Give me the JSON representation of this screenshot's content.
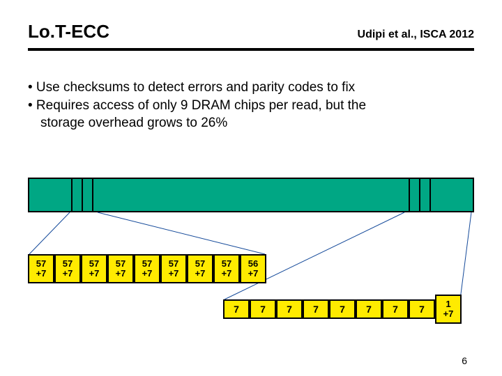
{
  "header": {
    "title": "Lo.T-ECC",
    "citation": "Udipi et al., ISCA 2012"
  },
  "bullets": {
    "b1": "• Use checksums to detect errors and parity codes to fix",
    "b2": "• Requires access of only 9 DRAM chips per read, but the",
    "b2b": "storage overhead grows to 26%"
  },
  "chips_row1": [
    {
      "top": "57",
      "bot": "+7"
    },
    {
      "top": "57",
      "bot": "+7"
    },
    {
      "top": "57",
      "bot": "+7"
    },
    {
      "top": "57",
      "bot": "+7"
    },
    {
      "top": "57",
      "bot": "+7"
    },
    {
      "top": "57",
      "bot": "+7"
    },
    {
      "top": "57",
      "bot": "+7"
    },
    {
      "top": "57",
      "bot": "+7"
    },
    {
      "top": "56",
      "bot": "+7"
    }
  ],
  "chips_row2": [
    {
      "v": "7"
    },
    {
      "v": "7"
    },
    {
      "v": "7"
    },
    {
      "v": "7"
    },
    {
      "v": "7"
    },
    {
      "v": "7"
    },
    {
      "v": "7"
    },
    {
      "v": "7"
    }
  ],
  "chips_row2_last": {
    "top": "1",
    "bot": "+7"
  },
  "page_number": "6"
}
